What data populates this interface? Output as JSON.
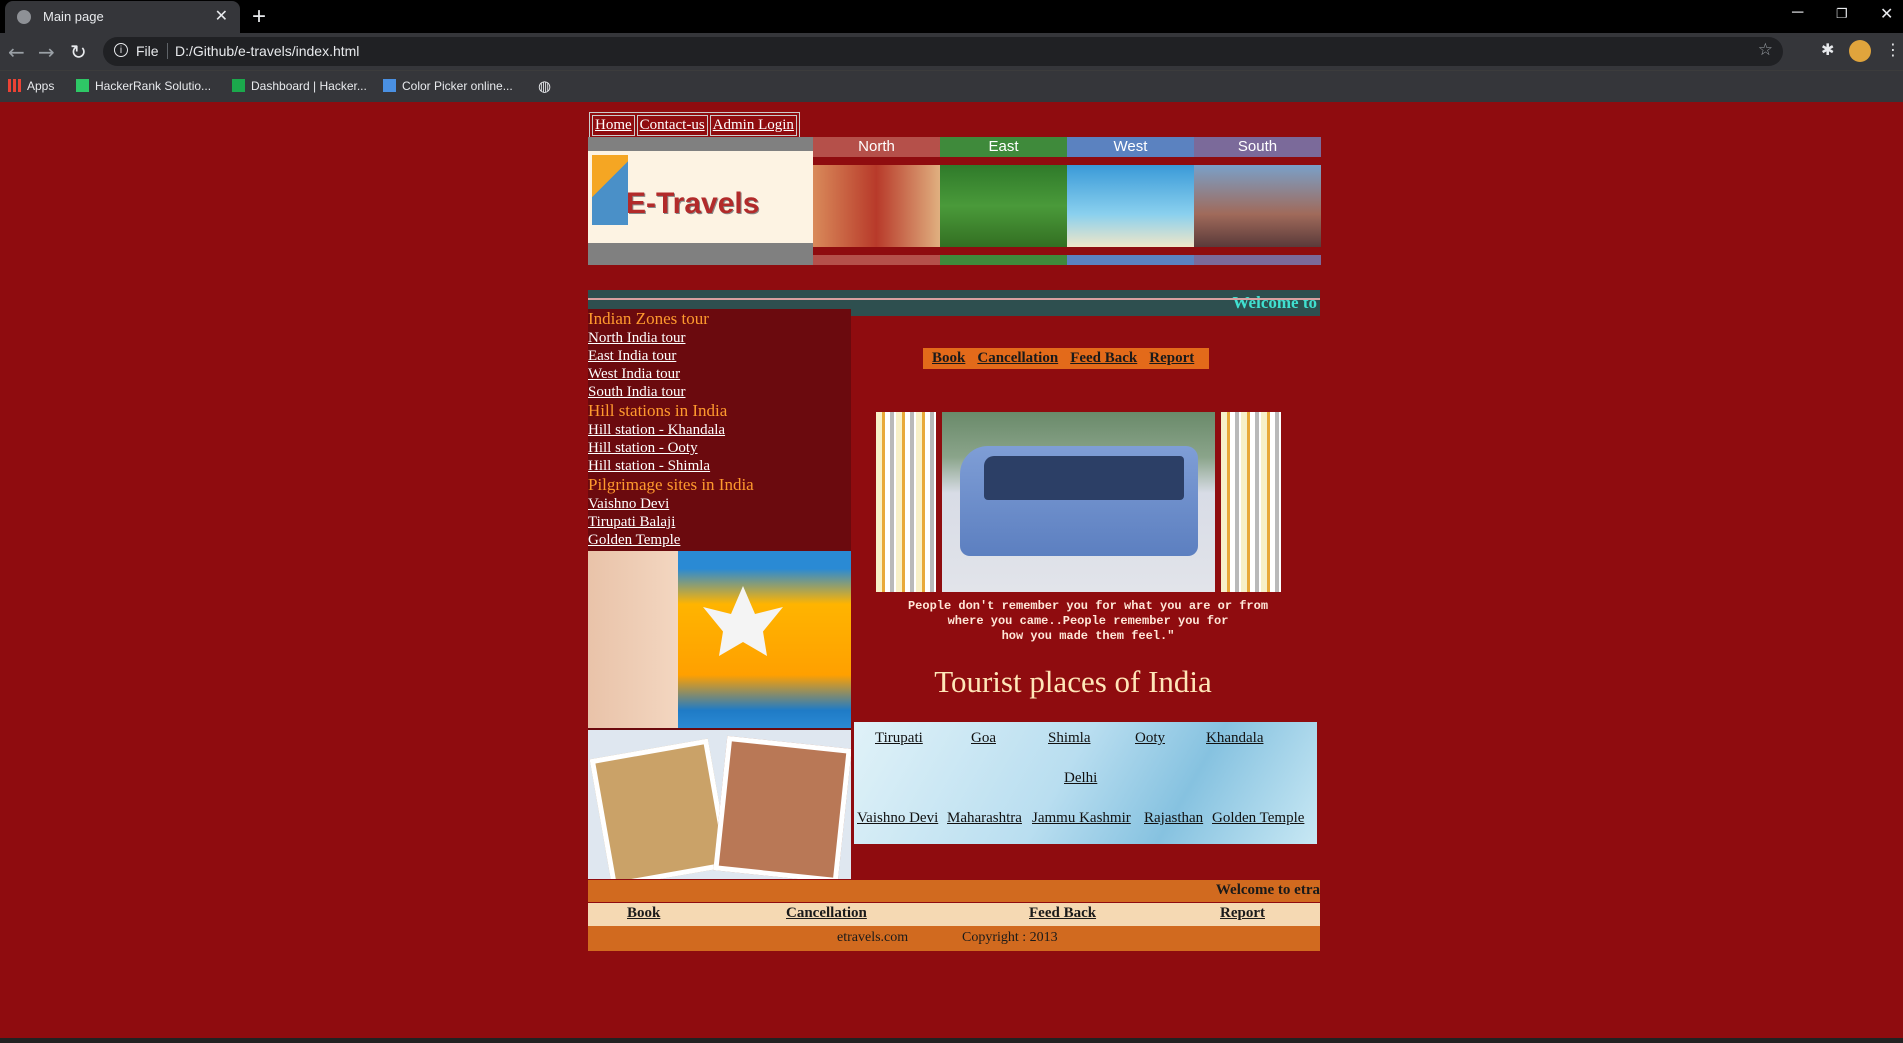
{
  "browser": {
    "tab_title": "Main page",
    "close_glyph": "✕",
    "new_tab_glyph": "+",
    "scheme": "File",
    "url": "D:/Github/e-travels/index.html",
    "bookmarks": [
      {
        "label": "Apps",
        "icon": "apps-grid-icon",
        "color": "#ea4335"
      },
      {
        "label": "HackerRank Solutio...",
        "icon": "hackerrank-icon",
        "color": "#2ec866"
      },
      {
        "label": "Dashboard | Hacker...",
        "icon": "hackerrank-dashboard-icon",
        "color": "#1ba94c"
      },
      {
        "label": "Color Picker online...",
        "icon": "color-picker-icon",
        "color": "#4a90e2"
      }
    ]
  },
  "page": {
    "topnav": [
      "Home",
      "Contact-us",
      "Admin Login"
    ],
    "logo_text": "E-Travels",
    "zones": [
      {
        "label": "North",
        "color": "#b5504a",
        "pic": "#c06a4a"
      },
      {
        "label": "East",
        "color": "#3f8a3b",
        "pic": "#4a8a32"
      },
      {
        "label": "West",
        "color": "#5b82c0",
        "pic": "#4aa0d8"
      },
      {
        "label": "South",
        "color": "#7b6a9a",
        "pic": "#9a7a7a"
      }
    ],
    "marquee_top": "Welcome to",
    "sidebar": {
      "sections": [
        {
          "title": "Indian Zones tour",
          "links": [
            "North India tour",
            "East India tour",
            "West India tour",
            "South India tour"
          ]
        },
        {
          "title": "Hill stations in India",
          "links": [
            "Hill station - Khandala",
            "Hill station - Ooty",
            "Hill station - Shimla"
          ]
        },
        {
          "title": "Pilgrimage sites in India",
          "links": [
            "Vaishno Devi",
            "Tirupati Balaji",
            "Golden Temple"
          ]
        }
      ]
    },
    "menu": [
      "Book",
      "Cancellation",
      "Feed Back",
      "Report"
    ],
    "quote_lines": [
      "People don't remember you for what you are or from",
      "where you came..People remember you for",
      "how you made them feel.\""
    ],
    "tour_title": "Tourist places of India",
    "places_row1": [
      "Tirupati",
      "Goa",
      "Shimla",
      "Ooty",
      "Khandala"
    ],
    "places_row2": [
      "Delhi"
    ],
    "places_row3": [
      "Vaishno Devi",
      "Maharashtra",
      "Jammu Kashmir",
      "Rajasthan",
      "Golden Temple"
    ],
    "ticker_bottom": "Welcome to etra",
    "footer_nav": [
      "Book",
      "Cancellation",
      "Feed Back",
      "Report"
    ],
    "footer_site": "etravels.com",
    "footer_copyright": "Copyright : 2013"
  }
}
